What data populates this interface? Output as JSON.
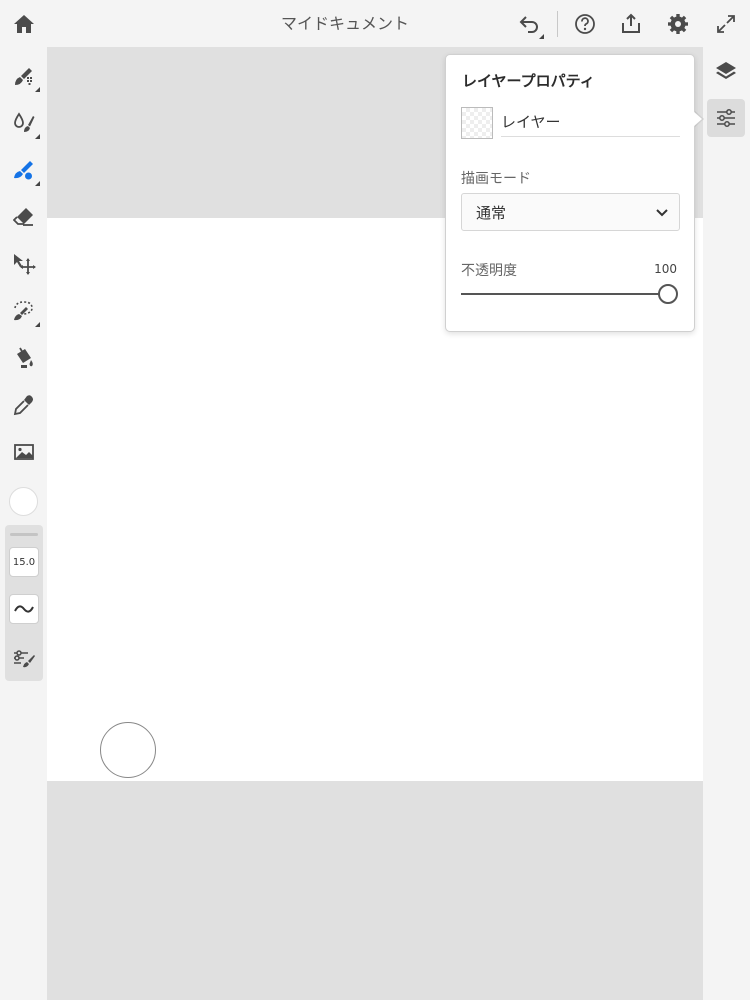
{
  "document": {
    "title": "マイドキュメント"
  },
  "colors": {
    "accent": "#1473e6",
    "icon": "#4b4b4b",
    "canvas_bg": "#e0e0e0"
  },
  "topbar": {
    "icons": [
      "home-icon",
      "undo-icon",
      "help-icon",
      "share-icon",
      "settings-icon",
      "fullscreen-icon"
    ]
  },
  "left_toolbar": {
    "tools": [
      "pixel-brush-icon",
      "live-brush-icon",
      "vector-brush-icon",
      "eraser-icon",
      "transform-icon",
      "lasso-icon",
      "fill-icon",
      "eyedropper-icon",
      "image-icon"
    ],
    "active_tool": "vector-brush-icon",
    "brush_size": "15.0"
  },
  "right_toolbar": {
    "icons": [
      "layers-icon",
      "layer-properties-icon"
    ],
    "active": "layer-properties-icon"
  },
  "layer_properties": {
    "title": "レイヤープロパティ",
    "layer_name": "レイヤー",
    "blend_mode_label": "描画モード",
    "blend_mode_value": "通常",
    "opacity_label": "不透明度",
    "opacity_value": "100"
  }
}
